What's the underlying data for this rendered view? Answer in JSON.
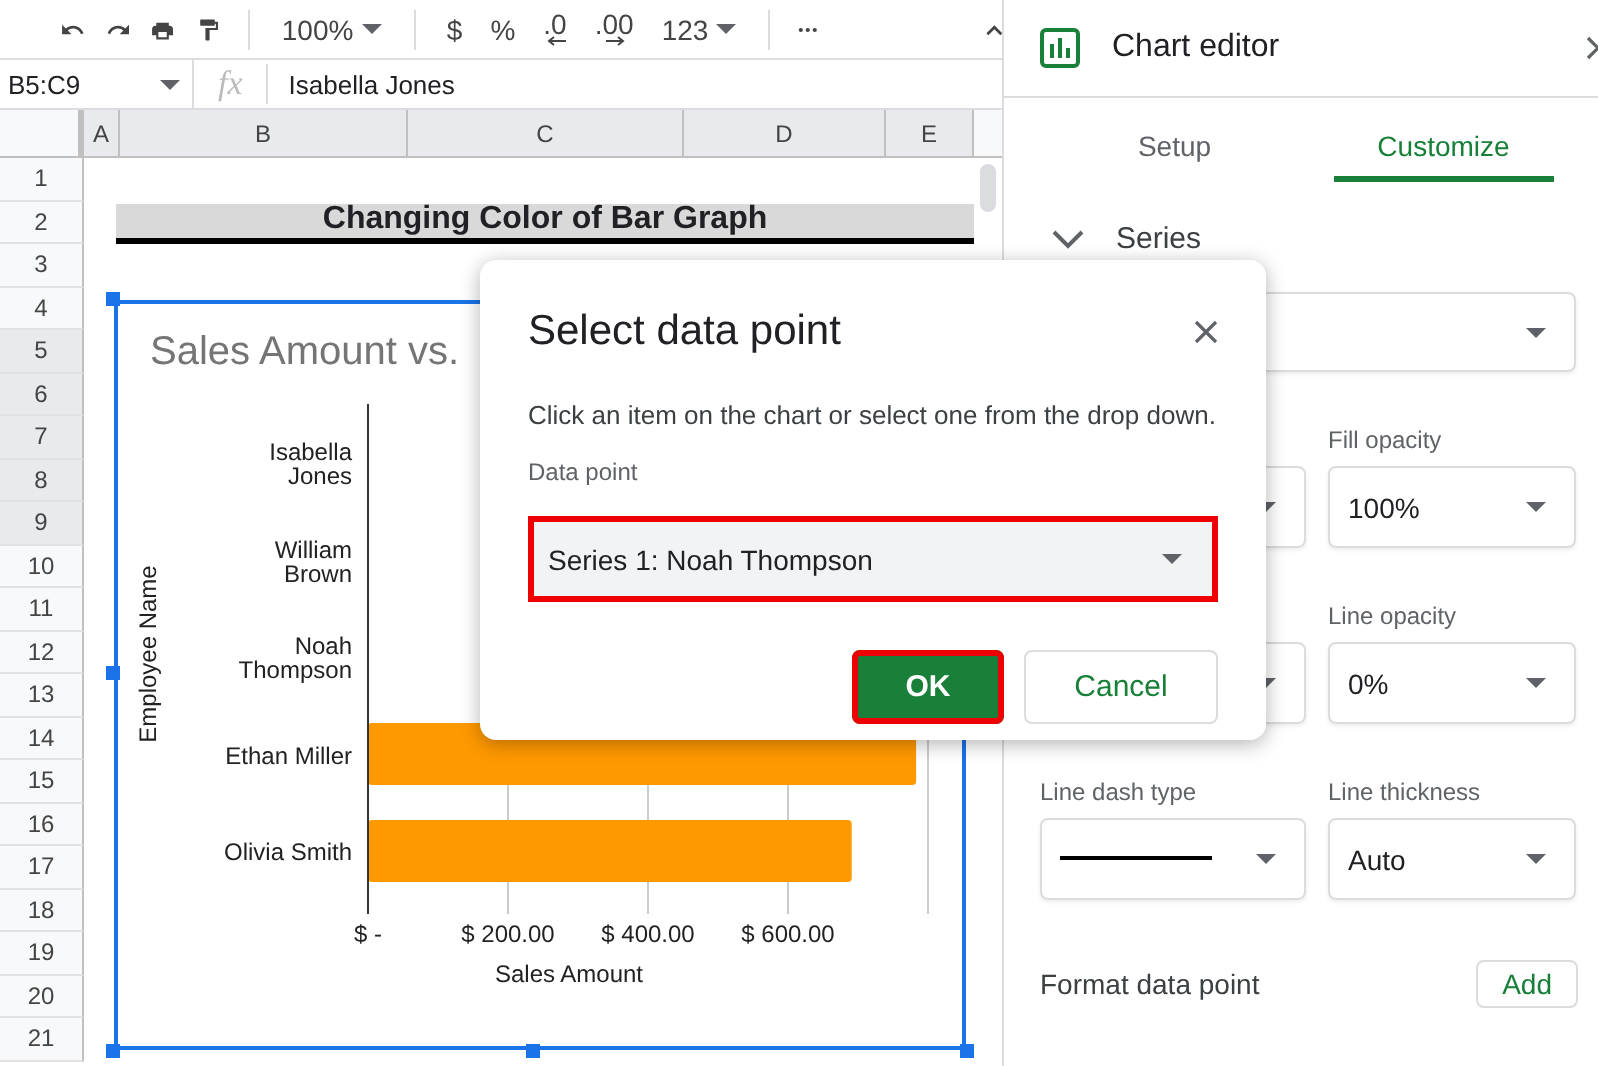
{
  "toolbar": {
    "zoom": "100%",
    "currency": "$",
    "percent": "%",
    "decrease_decimal": ".0",
    "increase_decimal": ".00",
    "number_format": "123"
  },
  "formula_bar": {
    "name_box": "B5:C9",
    "function_label": "fx",
    "content": "Isabella Jones"
  },
  "sheet": {
    "columns": [
      "A",
      "B",
      "C",
      "D",
      "E"
    ],
    "rows": [
      {
        "label": "1",
        "selected": false
      },
      {
        "label": "2",
        "selected": false
      },
      {
        "label": "3",
        "selected": false
      },
      {
        "label": "4",
        "selected": false
      },
      {
        "label": "5",
        "selected": true
      },
      {
        "label": "6",
        "selected": true
      },
      {
        "label": "7",
        "selected": true
      },
      {
        "label": "8",
        "selected": true
      },
      {
        "label": "9",
        "selected": true
      },
      {
        "label": "10",
        "selected": false
      },
      {
        "label": "11",
        "selected": false
      },
      {
        "label": "12",
        "selected": false
      },
      {
        "label": "13",
        "selected": false
      },
      {
        "label": "14",
        "selected": false
      },
      {
        "label": "15",
        "selected": false
      },
      {
        "label": "16",
        "selected": false
      },
      {
        "label": "17",
        "selected": false
      },
      {
        "label": "18",
        "selected": false
      },
      {
        "label": "19",
        "selected": false
      },
      {
        "label": "20",
        "selected": false
      },
      {
        "label": "21",
        "selected": false
      }
    ],
    "title_cell": "Changing Color of Bar Graph"
  },
  "chart": {
    "chart_data": {
      "type": "bar",
      "orientation": "horizontal",
      "title": "Sales Amount vs.",
      "xlabel": "Sales Amount",
      "ylabel": "Employee Name",
      "categories": [
        "Isabella Jones",
        "William Brown",
        "Noah Thompson",
        "Ethan Miller",
        "Olivia Smith"
      ],
      "series": [
        {
          "color": "#ff9900",
          "values": [
            null,
            null,
            null,
            783,
            691
          ]
        }
      ],
      "xlim": [
        0,
        800
      ],
      "xticks": [
        {
          "value": 0,
          "label": "$ -"
        },
        {
          "value": 200,
          "label": "$ 200.00"
        },
        {
          "value": 400,
          "label": "$ 400.00"
        },
        {
          "value": 600,
          "label": "$ 600.00"
        }
      ],
      "grid": true
    }
  },
  "dialog": {
    "title": "Select data point",
    "hint": "Click an item on the chart or select one from the drop down.",
    "field_label": "Data point",
    "value": "Series 1: Noah Thompson",
    "highlighted": true,
    "buttons": [
      {
        "label": "OK",
        "kind": "primary",
        "highlighted": true
      },
      {
        "label": "Cancel",
        "kind": "secondary",
        "highlighted": false
      }
    ]
  },
  "editor": {
    "title": "Chart editor",
    "tabs": [
      {
        "label": "Setup",
        "selected": false
      },
      {
        "label": "Customize",
        "selected": true
      }
    ],
    "section": {
      "label": "Series",
      "expanded": true
    },
    "fields": [
      {
        "kind": "wide-select"
      },
      {
        "kind": "select"
      },
      {
        "kind": "select",
        "label": "Fill opacity",
        "value": "100%"
      },
      {
        "kind": "select"
      },
      {
        "kind": "select",
        "label": "Line opacity",
        "value": "0%"
      },
      {
        "kind": "line-select",
        "label": "Line dash type"
      },
      {
        "kind": "select",
        "label": "Line thickness",
        "value": "Auto"
      }
    ],
    "format_point": {
      "label": "Format data point",
      "button": "Add"
    }
  }
}
